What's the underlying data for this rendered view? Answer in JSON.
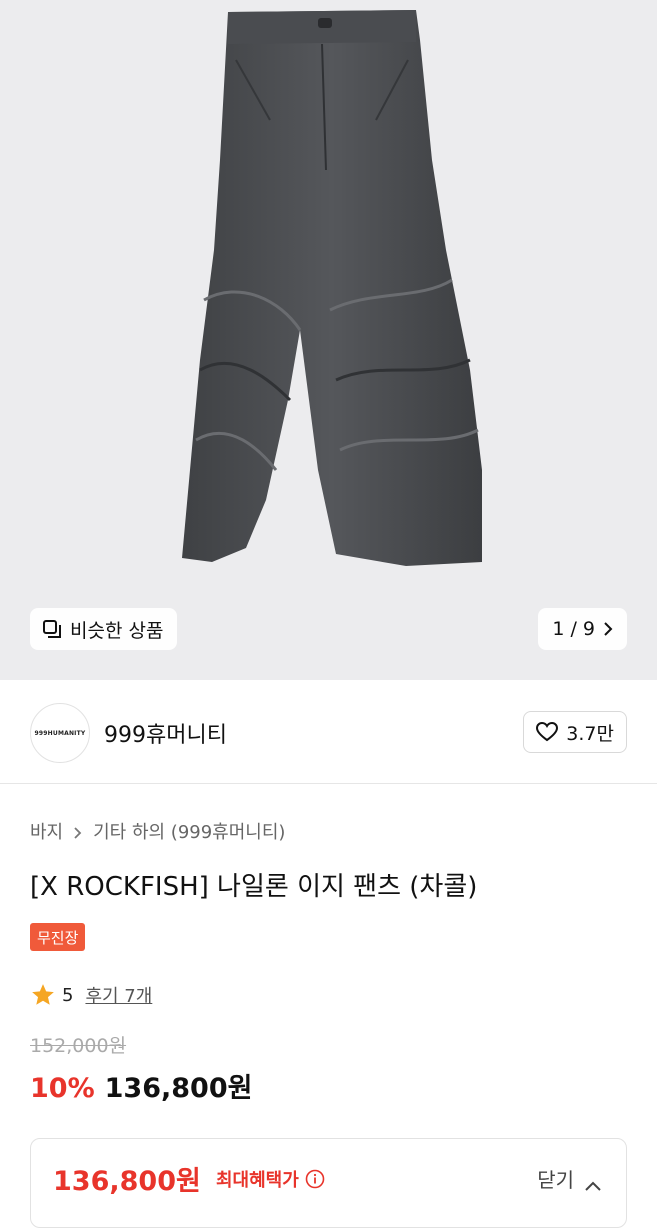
{
  "gallery": {
    "similar_label": "비슷한 상품",
    "pager": "1 / 9"
  },
  "seller": {
    "avatar_text": "999HUMANITY",
    "name": "999휴머니티",
    "likes": "3.7만"
  },
  "breadcrumb": {
    "category": "바지",
    "subcategory": "기타 하의 (999휴머니티)"
  },
  "product": {
    "title": "[X ROCKFISH] 나일론 이지 팬츠 (차콜)",
    "badge": "무진장",
    "rating": "5",
    "reviews": "후기 7개",
    "original_price": "152,000원",
    "discount": "10%",
    "price": "136,800원"
  },
  "benefit": {
    "price": "136,800원",
    "label": "최대혜택가",
    "toggle": "닫기"
  },
  "colors": {
    "accent": "#e8342b",
    "badge": "#f05a3a",
    "star": "#f5a623"
  }
}
